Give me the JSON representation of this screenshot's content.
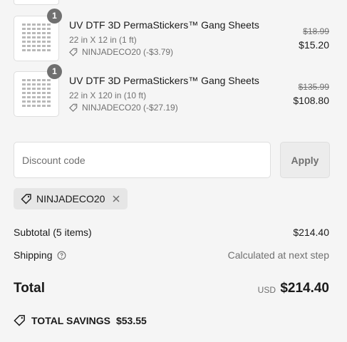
{
  "items": [
    {
      "quantity": "1",
      "title": "UV DTF 3D PermaStickers™ Gang Sheets",
      "variant": "22 in X 12 in (1 ft)",
      "discount": "NINJADECO20 (-$3.79)",
      "original_price": "$18.99",
      "price": "$15.20"
    },
    {
      "quantity": "1",
      "title": "UV DTF 3D PermaStickers™ Gang Sheets",
      "variant": "22 in X 120 in (10 ft)",
      "discount": "NINJADECO20 (-$27.19)",
      "original_price": "$135.99",
      "price": "$108.80"
    }
  ],
  "discount": {
    "placeholder": "Discount code",
    "apply_label": "Apply",
    "applied_code": "NINJADECO20"
  },
  "summary": {
    "subtotal_label": "Subtotal (5 items)",
    "subtotal_value": "$214.40",
    "shipping_label": "Shipping",
    "shipping_value": "Calculated at next step",
    "total_label": "Total",
    "currency": "USD",
    "total_value": "$214.40",
    "savings_label": "TOTAL SAVINGS",
    "savings_value": "$53.55"
  },
  "colors": {
    "background": "#f5f5f5",
    "text": "#1a1a1a",
    "muted": "#707070",
    "badge": "#707070"
  },
  "icons": [
    "tag-icon",
    "info-icon",
    "close-icon",
    "savings-tag-icon"
  ]
}
